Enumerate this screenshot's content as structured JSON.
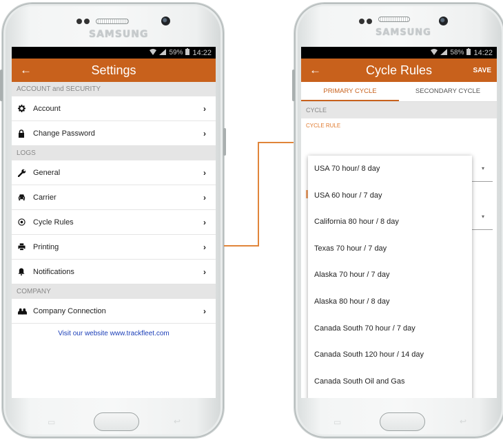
{
  "left_phone": {
    "brand": "SAMSUNG",
    "status": {
      "battery": "59%",
      "time": "14:22"
    },
    "appbar": {
      "title": "Settings"
    },
    "sections": [
      {
        "header": "ACCOUNT and SECURITY",
        "items": [
          {
            "label": "Account",
            "icon": "gear-icon"
          },
          {
            "label": "Change Password",
            "icon": "lock-icon"
          }
        ]
      },
      {
        "header": "LOGS",
        "items": [
          {
            "label": "General",
            "icon": "wrench-icon"
          },
          {
            "label": "Carrier",
            "icon": "car-icon"
          },
          {
            "label": "Cycle Rules",
            "icon": "target-icon"
          },
          {
            "label": "Printing",
            "icon": "printer-icon"
          },
          {
            "label": "Notifications",
            "icon": "bell-icon"
          }
        ]
      },
      {
        "header": "COMPANY",
        "items": [
          {
            "label": "Company Connection",
            "icon": "people-icon"
          }
        ]
      }
    ],
    "website_link": "Visit our website www.trackfleet.com"
  },
  "right_phone": {
    "brand": "SAMSUNG",
    "status": {
      "battery": "58%",
      "time": "14:22"
    },
    "appbar": {
      "title": "Cycle Rules",
      "save_label": "SAVE"
    },
    "tabs": [
      {
        "label": "PRIMARY CYCLE",
        "active": true
      },
      {
        "label": "SECONDARY CYCLE",
        "active": false
      }
    ],
    "section_header": "CYCLE",
    "field_label": "CYCLE RULE",
    "options": [
      "USA 70 hour/ 8 day",
      "USA 60 hour / 7 day",
      "California 80 hour / 8 day",
      "Texas 70 hour / 7 day",
      "Alaska 70 hour / 7 day",
      "Alaska 80 hour / 8 day",
      "Canada South 70 hour / 7 day",
      "Canada South 120 hour / 14 day",
      "Canada South Oil and Gas"
    ]
  },
  "colors": {
    "accent": "#c8611c",
    "link": "#1c3fb8",
    "connector": "#e08439"
  }
}
